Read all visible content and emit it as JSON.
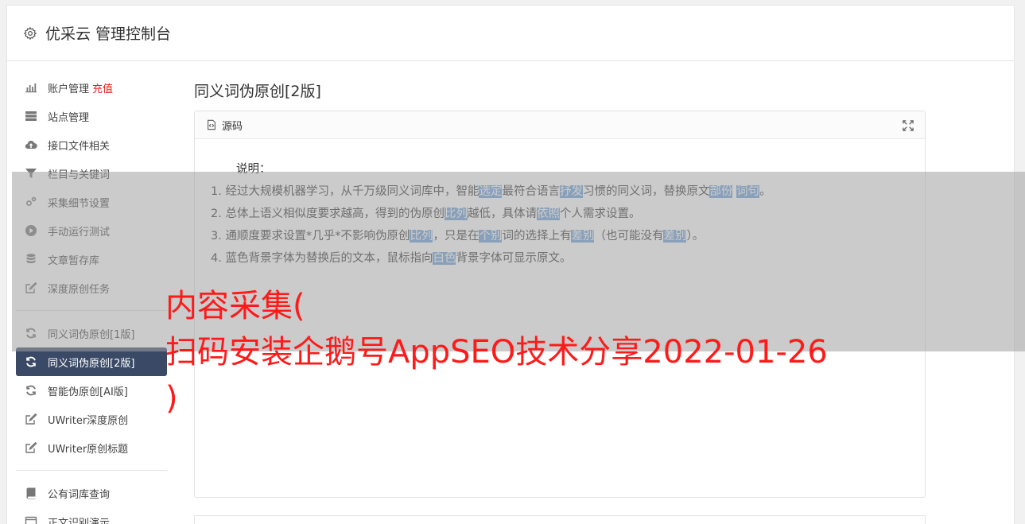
{
  "header": {
    "title": "优采云 管理控制台",
    "icon": "gear-icon"
  },
  "sidebar": {
    "groups": [
      [
        {
          "label": "账户管理",
          "extra": "充值",
          "icon": "bar-chart-icon"
        },
        {
          "label": "站点管理",
          "icon": "server-icon"
        },
        {
          "label": "接口文件相关",
          "icon": "cloud-upload-icon"
        },
        {
          "label": "栏目与关键词",
          "icon": "filter-icon"
        },
        {
          "label": "采集细节设置",
          "icon": "cogs-icon"
        },
        {
          "label": "手动运行测试",
          "icon": "play-circle-icon"
        },
        {
          "label": "文章暂存库",
          "icon": "database-icon"
        },
        {
          "label": "深度原创任务",
          "icon": "edit-icon"
        }
      ],
      [
        {
          "label": "同义词伪原创[1版]",
          "icon": "refresh-icon"
        },
        {
          "label": "同义词伪原创[2版]",
          "icon": "refresh-icon",
          "active": true
        },
        {
          "label": "智能伪原创[AI版]",
          "icon": "refresh-icon"
        },
        {
          "label": "UWriter深度原创",
          "icon": "edit-icon"
        },
        {
          "label": "UWriter原创标题",
          "icon": "edit-icon"
        }
      ],
      [
        {
          "label": "公有词库查询",
          "icon": "book-icon"
        },
        {
          "label": "正文识别演示",
          "icon": "window-icon"
        }
      ]
    ]
  },
  "main": {
    "title": "同义词伪原创[2版]",
    "panel": {
      "header_label": "源码",
      "intro": "说明：",
      "lines": [
        [
          {
            "t": "1. 经过大规模机器学习，从千万级同义词库中，智能"
          },
          {
            "t": "选定",
            "hl": true
          },
          {
            "t": "最符合语言"
          },
          {
            "t": "抒发",
            "hl": true
          },
          {
            "t": "习惯的同义词，替换原文"
          },
          {
            "t": "部份",
            "hl": true
          },
          {
            "t": " "
          },
          {
            "t": "词句",
            "hl": true
          },
          {
            "t": "。"
          }
        ],
        [
          {
            "t": "2. 总体上语义相似度要求越高，得到的伪原创"
          },
          {
            "t": "比列",
            "hl": true
          },
          {
            "t": "越低，具体请"
          },
          {
            "t": "依照",
            "hl": true
          },
          {
            "t": "个人需求设置。"
          }
        ],
        [
          {
            "t": "3. 通顺度要求设置*几乎*不影响伪原创"
          },
          {
            "t": "比列",
            "hl": true
          },
          {
            "t": "，只是在"
          },
          {
            "t": "个别",
            "hl": true
          },
          {
            "t": "词的选择上有"
          },
          {
            "t": "差别",
            "hl": true
          },
          {
            "t": "（也可能没有"
          },
          {
            "t": "差别",
            "hl": true
          },
          {
            "t": "）。"
          }
        ],
        [
          {
            "t": "4. 蓝色背景字体为替换后的文本，鼠标指向"
          },
          {
            "t": "白色",
            "hl": true
          },
          {
            "t": "背景字体可显示原文。"
          }
        ]
      ]
    }
  },
  "watermark": {
    "lines": [
      "内容采集(",
      "扫码安装企鹅号AppSEO技术分享2022-01-26",
      ")"
    ]
  },
  "colors": {
    "active_nav": "#3a4a66",
    "highlight": "#6d9fd9",
    "watermark": "#ff1a1a",
    "recharge": "#e02020"
  }
}
